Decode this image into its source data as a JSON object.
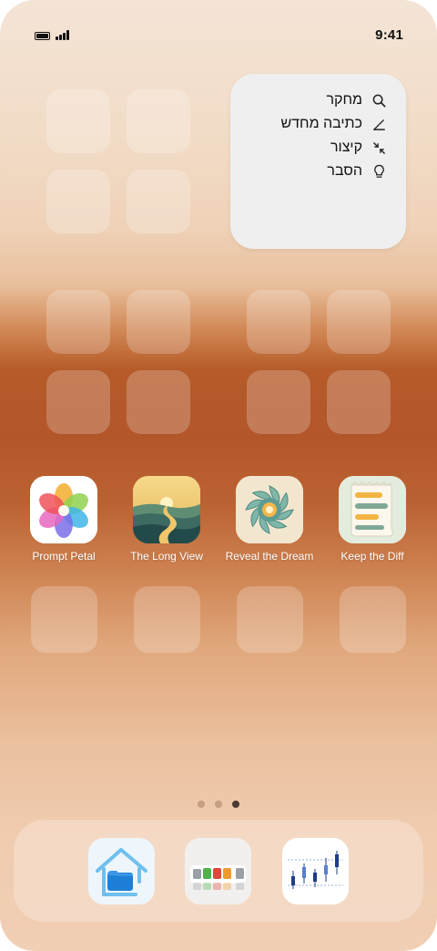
{
  "status_bar": {
    "time": "9:41"
  },
  "widget": {
    "items": [
      {
        "label": "מחקר",
        "icon": "search-icon"
      },
      {
        "label": "כתיבה מחדש",
        "icon": "pencil-icon"
      },
      {
        "label": "קיצור",
        "icon": "shrink-arrows-icon"
      },
      {
        "label": "הסבר",
        "icon": "lightbulb-icon"
      }
    ]
  },
  "apps": [
    {
      "name": "Prompt Petal",
      "icon": "flower-petal-icon"
    },
    {
      "name": "The Long View",
      "icon": "winding-road-icon"
    },
    {
      "name": "Reveal the Dream",
      "icon": "aperture-flower-icon"
    },
    {
      "name": "Keep the Diff",
      "icon": "receipt-diff-icon"
    }
  ],
  "page_indicator": {
    "pages": 3,
    "current": 3
  },
  "dock": {
    "apps": [
      {
        "icon": "home-folder-icon"
      },
      {
        "icon": "color-palette-grid-icon"
      },
      {
        "icon": "candlestick-chart-icon"
      }
    ]
  },
  "colors": {
    "wallpaper_top": "#f4e4d6",
    "wallpaper_band": "#b3572a",
    "widget_bg": "#efefef",
    "label_text": "#ffffff"
  }
}
